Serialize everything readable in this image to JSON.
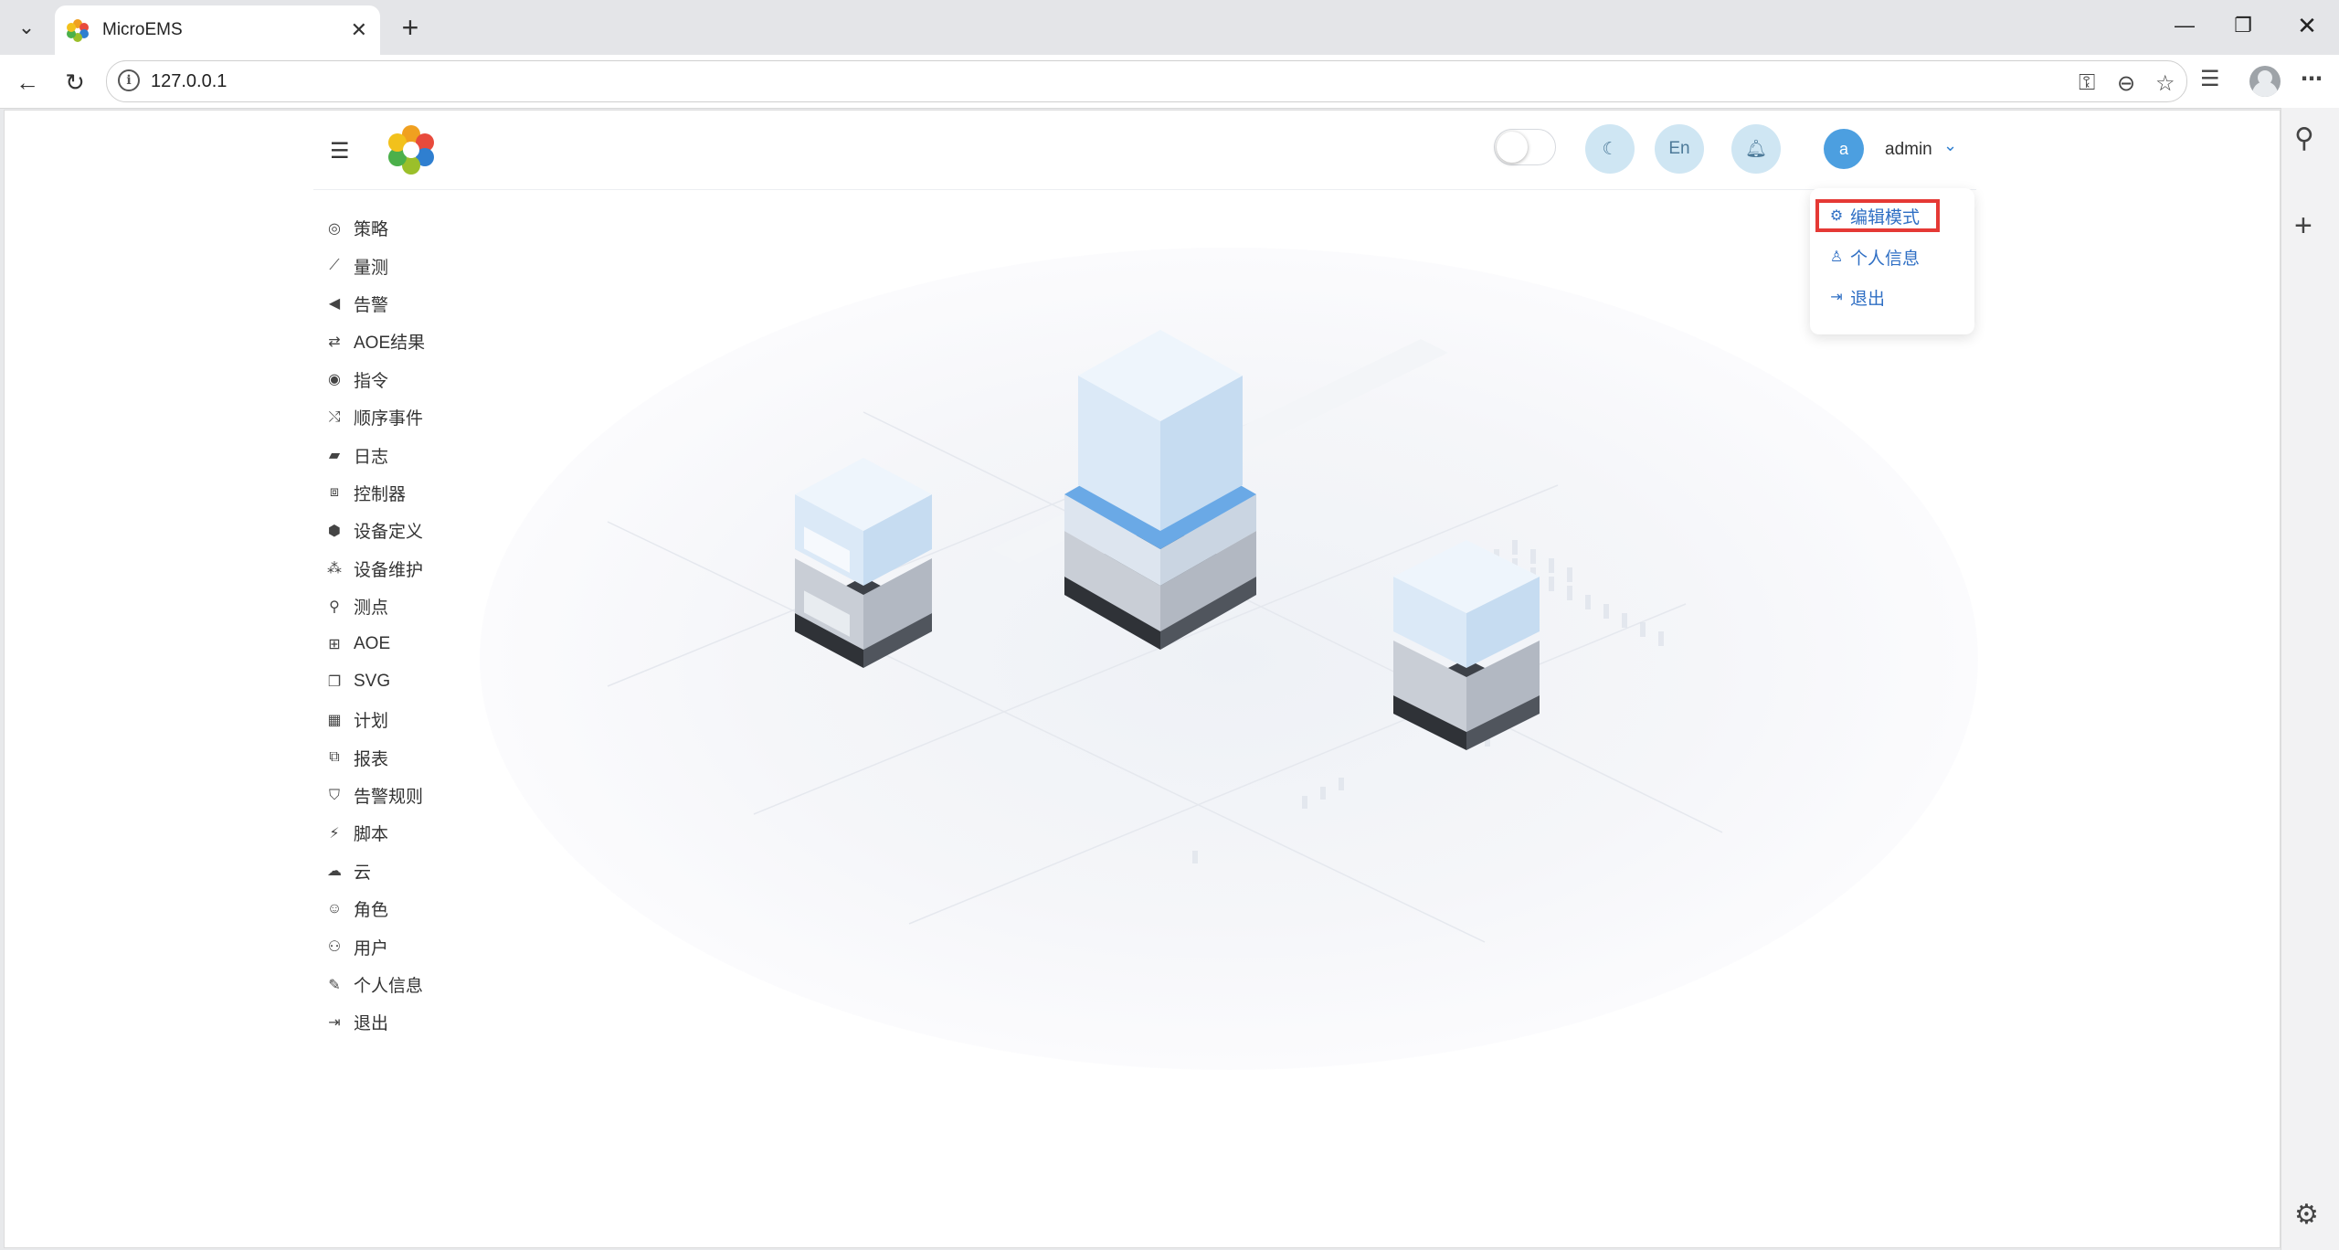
{
  "browser": {
    "tab_title": "MicroEMS",
    "url": "127.0.0.1",
    "tab_close": "✕",
    "new_tab": "+"
  },
  "header": {
    "theme_toggle_on": false,
    "lang_label": "En",
    "user_avatar_letter": "a",
    "user_name": "admin"
  },
  "dropdown": {
    "items": [
      {
        "icon": "gears-icon",
        "label": "编辑模式",
        "highlighted": true
      },
      {
        "icon": "user-icon",
        "label": "个人信息"
      },
      {
        "icon": "logout-icon",
        "label": "退出"
      }
    ],
    "highlight_color": "#e53935"
  },
  "sidebar": {
    "items": [
      {
        "icon": "compass-icon",
        "label": "策略"
      },
      {
        "icon": "chart-line-icon",
        "label": "量测"
      },
      {
        "icon": "bullhorn-icon",
        "label": "告警"
      },
      {
        "icon": "retweet-icon",
        "label": "AOE结果"
      },
      {
        "icon": "podcast-icon",
        "label": "指令"
      },
      {
        "icon": "random-icon",
        "label": "顺序事件"
      },
      {
        "icon": "book-icon",
        "label": "日志"
      },
      {
        "icon": "object-group-icon",
        "label": "控制器"
      },
      {
        "icon": "cube-icon",
        "label": "设备定义"
      },
      {
        "icon": "cubes-icon",
        "label": "设备维护"
      },
      {
        "icon": "map-pin-icon",
        "label": "测点"
      },
      {
        "icon": "sitemap-icon",
        "label": "AOE"
      },
      {
        "icon": "clone-icon",
        "label": "SVG"
      },
      {
        "icon": "calendar-icon",
        "label": "计划"
      },
      {
        "icon": "copy-icon",
        "label": "报表"
      },
      {
        "icon": "shield-icon",
        "label": "告警规则"
      },
      {
        "icon": "plug-icon",
        "label": "脚本"
      },
      {
        "icon": "cloud-icon",
        "label": "云"
      },
      {
        "icon": "user-circle-icon",
        "label": "角色"
      },
      {
        "icon": "users-icon",
        "label": "用户"
      },
      {
        "icon": "edit-icon",
        "label": "个人信息"
      },
      {
        "icon": "sign-out-icon",
        "label": "退出"
      }
    ]
  },
  "colors": {
    "accent": "#2f6fc4",
    "circle_button_bg": "#cfe6f3",
    "avatar_bg": "#4c9fe0"
  }
}
